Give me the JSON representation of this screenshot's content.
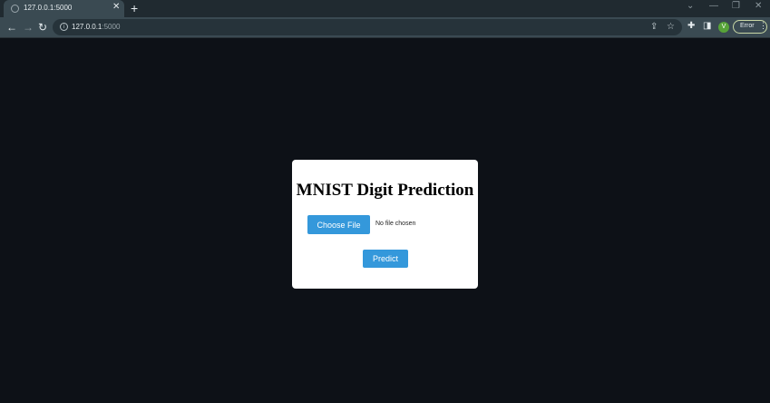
{
  "browser": {
    "tab": {
      "title": "127.0.0.1:5000",
      "close_glyph": "✕",
      "favicon": "globe-icon"
    },
    "new_tab_glyph": "+",
    "window_controls": {
      "tab_search": "⌄",
      "minimize": "—",
      "restore": "❐",
      "close": "✕"
    },
    "nav": {
      "back": "←",
      "forward": "→",
      "reload": "↻"
    },
    "address": {
      "host": "127.0.0.1",
      "port": ":5000"
    },
    "omni_icons": {
      "share": "⇪",
      "bookmark": "☆"
    },
    "toolbar_icons": {
      "extensions": "✚",
      "side_panel": "◨"
    },
    "profile": {
      "initial": "V",
      "color": "#57a338"
    },
    "error_chip": {
      "label": "Error",
      "menu": "⋮"
    }
  },
  "page": {
    "heading": "MNIST Digit Prediction",
    "file_input": {
      "button_label": "Choose File",
      "status": "No file chosen"
    },
    "predict_label": "Predict",
    "accent_color": "#3498db",
    "background_color": "#0d1117"
  }
}
